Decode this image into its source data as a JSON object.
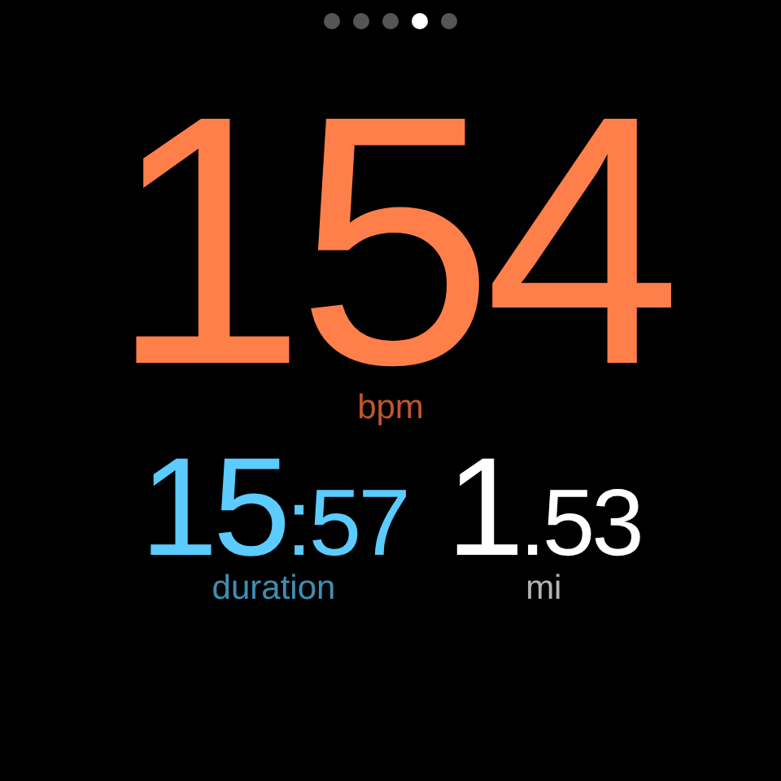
{
  "page_dots": [
    {
      "selected": false
    },
    {
      "selected": false
    },
    {
      "selected": false
    },
    {
      "selected": true
    },
    {
      "selected": false
    }
  ],
  "heart_rate": {
    "value": "154",
    "unit": "bpm"
  },
  "stats": [
    {
      "major": "15",
      "minor": ":57",
      "label": "duration",
      "color": "#5ccbff"
    },
    {
      "major": "1",
      "minor": ".53",
      "label": "mi",
      "color": "#ffffff"
    }
  ]
}
